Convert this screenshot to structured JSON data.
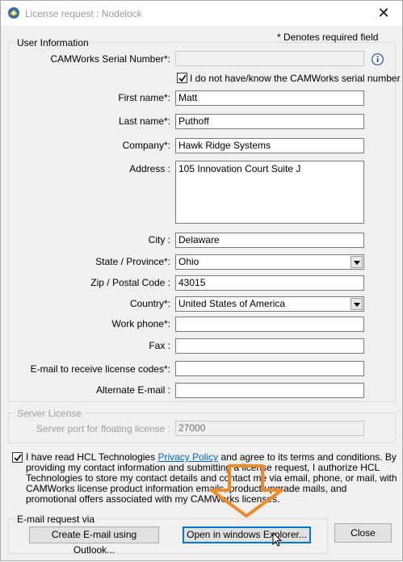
{
  "window": {
    "title": "License request : Nodelock",
    "close_glyph": "✕"
  },
  "user_info": {
    "group_title": "User Information",
    "required_note": "* Denotes required field",
    "serial": {
      "label": "CAMWorks Serial Number*:",
      "value": ""
    },
    "no_serial": {
      "label": "I do not have/know the CAMWorks serial number",
      "checked": true
    },
    "first_name": {
      "label": "First name*:",
      "value": "Matt"
    },
    "last_name": {
      "label": "Last name*:",
      "value": "Puthoff"
    },
    "company": {
      "label": "Company*:",
      "value": "Hawk Ridge Systems"
    },
    "address": {
      "label": "Address :",
      "value": "105 Innovation Court Suite J"
    },
    "city": {
      "label": "City :",
      "value": "Delaware"
    },
    "state": {
      "label": "State / Province*:",
      "value": "Ohio"
    },
    "zip": {
      "label": "Zip / Postal Code :",
      "value": "43015"
    },
    "country": {
      "label": "Country*:",
      "value": "United States of America"
    },
    "work_phone": {
      "label": "Work phone*:",
      "value": ""
    },
    "fax": {
      "label": "Fax :",
      "value": ""
    },
    "email": {
      "label": "E-mail to receive license codes*:",
      "value": ""
    },
    "alt_email": {
      "label": "Alternate E-mail :",
      "value": ""
    }
  },
  "server_license": {
    "group_title": "Server License",
    "port": {
      "label": "Server port for floating license :",
      "value": "27000"
    }
  },
  "consent": {
    "checked": true,
    "text_before": "I have read HCL Technologies ",
    "link": "Privacy Policy",
    "text_after": " and agree to its terms and conditions. By providing my contact information and submitting a license request, I authorize HCL Technologies to store my contact details and contact me via email, phone, or mail, with CAMWorks license product information emails, product upgrade mails, and promotional offers associated with my CAMWorks licenses."
  },
  "email_request": {
    "group_title": "E-mail request via",
    "outlook_button": "Create E-mail using Outlook...",
    "explorer_button": "Open in windows Explorer..."
  },
  "close_button": "Close",
  "colors": {
    "annotation_arrow": "#f08a24",
    "link": "#0066cc",
    "default_button_border": "#0078d7"
  },
  "icons": {
    "app": "camworks-app-icon",
    "info": "info-icon",
    "cursor": "mouse-pointer-icon"
  }
}
